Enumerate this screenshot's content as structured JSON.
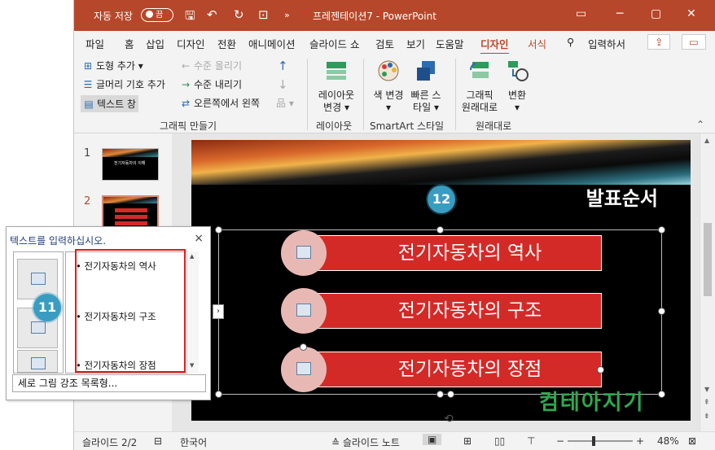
{
  "titlebar": {
    "autosave_label": "자동 저장",
    "autosave_state": "끔",
    "doc_title": "프레젠테이션7 - PowerPoint"
  },
  "tabs": [
    "파일",
    "홈",
    "삽입",
    "디자인",
    "전환",
    "애니메이션",
    "슬라이드 쇼",
    "검토",
    "보기",
    "도움말",
    "디자인",
    "서식"
  ],
  "tell_me": "입력하서",
  "ribbon": {
    "create": {
      "add_shape": "도형 추가",
      "add_bullet": "글머리 기호 추가",
      "text_pane": "텍스트 창",
      "promote": "수준 올리기",
      "demote": "수준 내리기",
      "rtl": "오른쪽에서 왼쪽",
      "label": "그래픽 만들기"
    },
    "layout": {
      "change": "레이아웃",
      "change2": "변경",
      "label": "레이아웃"
    },
    "styles": {
      "color": "색 변경",
      "quick": "빠른 스",
      "quick2": "타일",
      "label": "SmartArt 스타일"
    },
    "reset": {
      "reset": "그래픽",
      "reset2": "원래대로",
      "convert": "변환",
      "label": "원래대로"
    }
  },
  "thumbnails": [
    {
      "num": "1",
      "title": "전기자동차의 이해"
    },
    {
      "num": "2"
    }
  ],
  "slide": {
    "title": "발표순서",
    "items": [
      "전기자동차의 역사",
      "전기자동차의 구조",
      "전기자동차의 장점"
    ]
  },
  "textpane": {
    "title": "텍스트를 입력하십시오.",
    "close": "×",
    "bullets": [
      "전기자동차의 역사",
      "전기자동차의 구조",
      "전기자동차의 장점"
    ],
    "footer": "세로 그림 강조 목록형..."
  },
  "badges": {
    "b11": "11",
    "b12": "12"
  },
  "watermark": "컴테아지기",
  "status": {
    "slide": "슬라이드 2/2",
    "lang": "한국어",
    "notes": "슬라이드 노트",
    "zoom": "48%"
  },
  "colors": {
    "accent": "#b7472a",
    "bar": "#d42a27",
    "badge": "#3a9cc1",
    "highlight": "#e21b1b"
  }
}
